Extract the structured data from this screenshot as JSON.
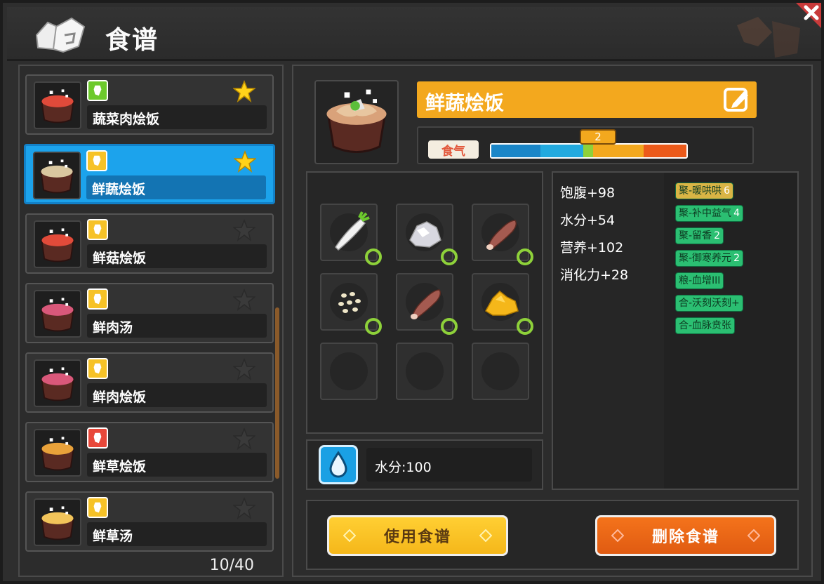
{
  "window": {
    "title": "食谱",
    "colors": {
      "accent": "#f3a81e",
      "selected": "#1ca3ec",
      "tag_green": "#2bbf72",
      "tag_gold": "#d9b545"
    }
  },
  "recipes": [
    {
      "name": "蔬菜肉烩饭",
      "badge_color": "#6cc92c",
      "favorite": true,
      "selected": false
    },
    {
      "name": "鲜蔬烩饭",
      "badge_color": "#f6c227",
      "favorite": true,
      "selected": true
    },
    {
      "name": "鲜菇烩饭",
      "badge_color": "#f6c227",
      "favorite": false,
      "selected": false
    },
    {
      "name": "鲜肉汤",
      "badge_color": "#f6c227",
      "favorite": false,
      "selected": false
    },
    {
      "name": "鲜肉烩饭",
      "badge_color": "#f6c227",
      "favorite": false,
      "selected": false
    },
    {
      "name": "鲜草烩饭",
      "badge_color": "#e8483a",
      "favorite": false,
      "selected": false
    },
    {
      "name": "鲜草汤",
      "badge_color": "#f6c227",
      "favorite": false,
      "selected": false
    }
  ],
  "list_count": "10/40",
  "detail": {
    "title": "鲜蔬烩饭",
    "qi_label": "食气",
    "qi_value": "2",
    "ingredients": [
      "radish-icon",
      "salt-icon",
      "sausage-icon",
      "seeds-icon",
      "sausage-icon",
      "golden-grain-icon",
      "empty",
      "empty",
      "empty"
    ],
    "water": "水分:100",
    "stats": [
      "饱腹+98",
      "水分+54",
      "营养+102",
      "消化力+28"
    ],
    "tags": [
      {
        "text": "聚-暖哄哄",
        "level": "6",
        "color": "#d9b545"
      },
      {
        "text": "聚-补中益气",
        "level": "4",
        "color": "#2bbf72"
      },
      {
        "text": "聚-留香",
        "level": "2",
        "color": "#2bbf72"
      },
      {
        "text": "聚-御寒养元",
        "level": "2",
        "color": "#2bbf72"
      },
      {
        "text": "粮-血增III",
        "level": "",
        "color": "#2bbf72"
      },
      {
        "text": "合-沃刻沃刻+",
        "level": "",
        "color": "#2bbf72"
      },
      {
        "text": "合-血脉贲张",
        "level": "",
        "color": "#2bbf72"
      }
    ],
    "buttons": {
      "use": "使用食谱",
      "delete": "删除食谱"
    }
  }
}
